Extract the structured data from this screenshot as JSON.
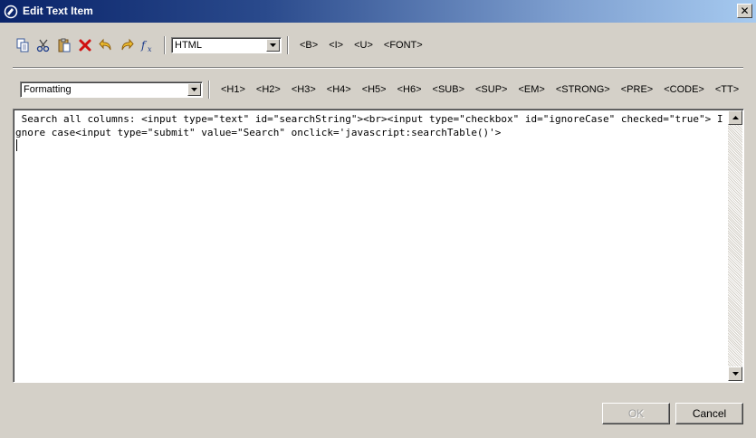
{
  "window": {
    "title": "Edit Text Item",
    "close_icon": "close-icon",
    "app_icon": "text-item-icon"
  },
  "toolbar": {
    "icons": [
      "copy-icon",
      "cut-icon",
      "paste-icon",
      "delete-icon",
      "undo-icon",
      "redo-icon",
      "expression-fx-icon"
    ],
    "content_type": "HTML",
    "format_tags": [
      "<B>",
      "<I>",
      "<U>",
      "<FONT>"
    ]
  },
  "formatting": {
    "select_value": "Formatting",
    "tags": [
      "<H1>",
      "<H2>",
      "<H3>",
      "<H4>",
      "<H5>",
      "<H6>",
      "<SUB>",
      "<SUP>",
      "<EM>",
      "<STRONG>",
      "<PRE>",
      "<CODE>",
      "<TT>"
    ]
  },
  "editor": {
    "content": " Search all columns: <input type=\"text\" id=\"searchString\"><br><input type=\"checkbox\" id=\"ignoreCase\" checked=\"true\"> Ignore case<input type=\"submit\" value=\"Search\" onclick='javascript:searchTable()'>"
  },
  "buttons": {
    "ok": "OK",
    "cancel": "Cancel"
  }
}
